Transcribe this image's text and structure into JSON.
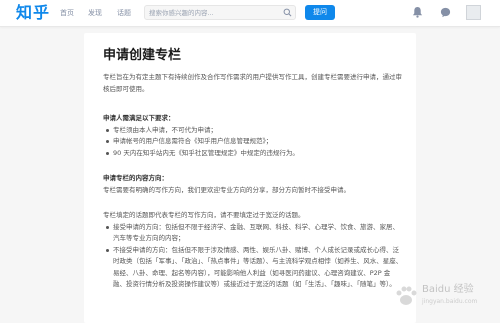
{
  "header": {
    "logo": "知乎",
    "nav": [
      "首页",
      "发现",
      "话题"
    ],
    "search_placeholder": "搜索你感兴趣的内容...",
    "ask_label": "提问"
  },
  "article": {
    "title": "申请创建专栏",
    "intro": "专栏旨在为有定主题下有持续创作及合作写作需求的用户提供写作工具，创建专栏需要进行申请，通过审核后即可使用。",
    "requirements_heading": "申请人需满足以下要求：",
    "requirements": [
      "专栏须由本人申请，不可代为申请；",
      "申请帐号的用户信息需符合《知乎用户信息管理规范》；",
      "90 天内在知乎站内无《知乎社区管理规定》中规定的违规行为。"
    ],
    "content_heading": "申请专栏的内容方向：",
    "content_text": "专栏需要有明确的写作方向，我们更欢迎专业方向的分享，部分方向暂时不接受申请。",
    "topics_text": "专栏填定的话题即代表专栏的写作方向，请不要填定过于宽泛的话题。",
    "topics": [
      "接受申请的方向：包括但不限于经济学、金融、互联网、科技、科学、心理学、饮食、旅游、家居、汽车等专业方向的内容；",
      "不接受申请的方向：包括但不限于涉及情感、两性、娱乐八卦、赌博、个人成长记录或成长心得、泛时政类（包括「军事」、「政治」、「热点事件」等话题）、与主流科学观点相悖（如养生、风水、星座、易经、八卦、命理、起名等内容），可能影响他人利益（如寻医问药建议、心理咨询建议、P2P 金融、投资行情分析及投资操作建议等）或接近过于宽泛的话题（如「生活」、「趣味」、「随笔」等）。"
    ]
  },
  "watermark": {
    "brand": "Baidu 经验",
    "url": "jingyan.baidu.com"
  }
}
